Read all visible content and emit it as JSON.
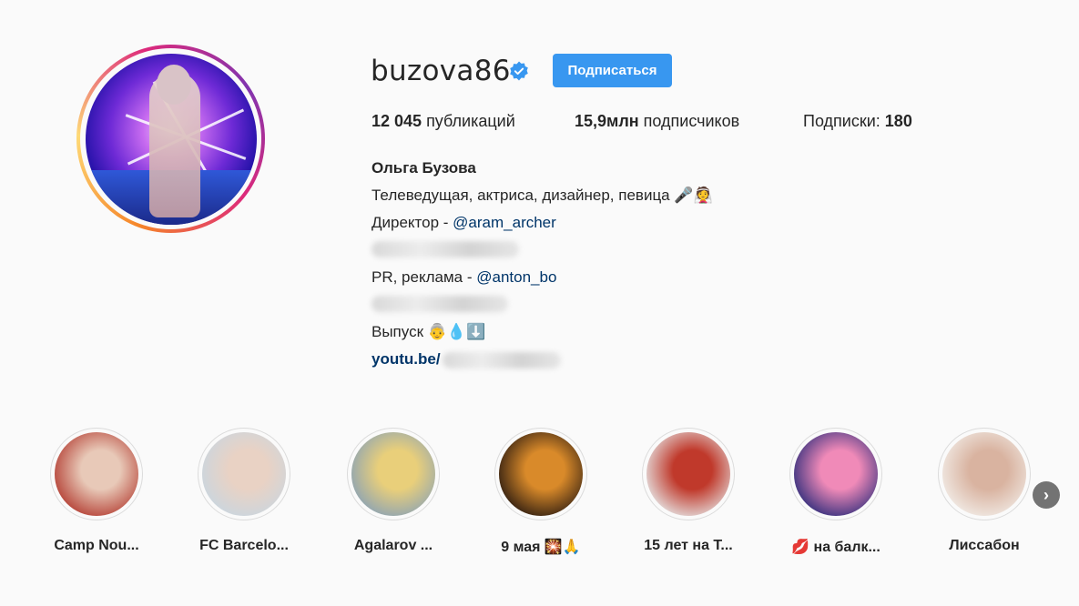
{
  "profile": {
    "username": "buzova86",
    "follow_label": "Подписаться",
    "posts_count": "12 045",
    "posts_label": " публикаций",
    "followers_count": "15,9млн",
    "followers_label": " подписчиков",
    "following_label": "Подписки: ",
    "following_count": "180",
    "full_name": "Ольга Бузова",
    "bio": {
      "line1": "Телеведущая, актриса, дизайнер, певица 🎤👰",
      "line2_prefix": "Директор - ",
      "line2_mention": "@aram_archer",
      "line4_prefix": "PR, реклама - ",
      "line4_mention": "@anton_bo",
      "line6": "Выпуск 👵💧⬇️",
      "link_text": "youtu.be/"
    }
  },
  "highlights": [
    {
      "label": "Camp Nou...",
      "colors": [
        "#b23a2f",
        "#e8c9b8"
      ]
    },
    {
      "label": "FC Barcelo...",
      "colors": [
        "#c9d6e0",
        "#e9d2c4"
      ]
    },
    {
      "label": "Agalarov ...",
      "colors": [
        "#8aa2b6",
        "#e9cf7a"
      ]
    },
    {
      "label": "9 мая 🎇🙏",
      "colors": [
        "#2a1a10",
        "#d98a2a"
      ]
    },
    {
      "label": "15 лет на Т...",
      "colors": [
        "#e6e6e6",
        "#c0392b"
      ]
    },
    {
      "label": "💋 на балк...",
      "colors": [
        "#2b2b7a",
        "#f08ab8"
      ]
    },
    {
      "label": "Лиссабон",
      "colors": [
        "#f2ede8",
        "#d9b3a0"
      ]
    }
  ],
  "icons": {
    "verified": "verified-badge-icon",
    "next": "chevron-right-icon"
  },
  "colors": {
    "accent": "#3897f0",
    "link": "#003569",
    "text": "#262626"
  }
}
